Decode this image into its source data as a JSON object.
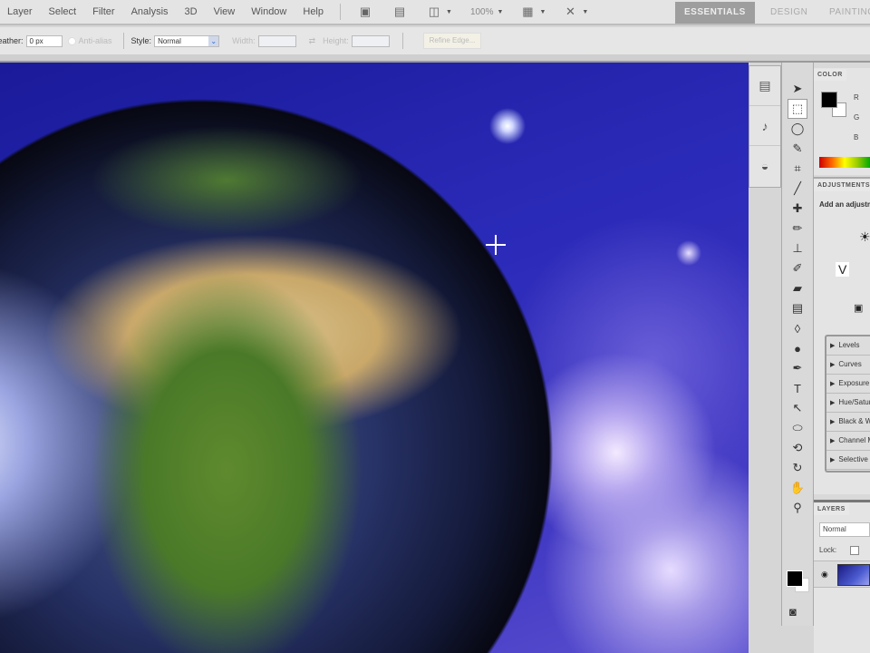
{
  "menubar": {
    "items": [
      "Layer",
      "Select",
      "Filter",
      "Analysis",
      "3D",
      "View",
      "Window",
      "Help"
    ],
    "zoom_level": "100%",
    "workspaces": {
      "active": "ESSENTIALS",
      "design": "DESIGN",
      "painting": "PAINTING"
    }
  },
  "options": {
    "feather_label": "Feather:",
    "feather_value": "0 px",
    "antialias_label": "Anti-alias",
    "style_label": "Style:",
    "style_value": "Normal",
    "width_label": "Width:",
    "height_label": "Height:",
    "refine_edge": "Refine Edge..."
  },
  "color_panel": {
    "title": "COLOR",
    "channels": [
      "R",
      "G",
      "B"
    ],
    "foreground": "#000000",
    "background": "#ffffff"
  },
  "adjustments_panel": {
    "title": "ADJUSTMENTS",
    "hint": "Add an adjustment",
    "presets": [
      "Levels",
      "Curves",
      "Exposure",
      "Hue/Saturation",
      "Black & White",
      "Channel Mixer",
      "Selective Color"
    ]
  },
  "layers_panel": {
    "title": "LAYERS",
    "blend_mode": "Normal",
    "lock_label": "Lock:"
  }
}
